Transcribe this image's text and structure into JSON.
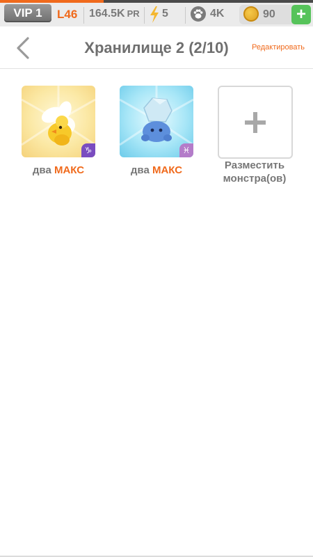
{
  "status_bar": {
    "vip_label": "VIP 1",
    "level": "L46",
    "power_value": "164.5K",
    "power_unit": "PR",
    "energy": "5",
    "paws": "4K",
    "coins": "90",
    "add_label": "+",
    "xp_progress_percent": 33,
    "colors": {
      "accent": "#f06a1c",
      "green": "#56c35a",
      "vip_gray": "#7a7a7a"
    }
  },
  "header": {
    "title": "Хранилище 2 (2/10)",
    "edit_label": "Редактировать"
  },
  "storage": {
    "slots": [
      {
        "prefix": "два",
        "rank": "МАКС",
        "zodiac_symbol": "♑",
        "theme": "yellow"
      },
      {
        "prefix": "два",
        "rank": "МАКС",
        "zodiac_symbol": "♓",
        "theme": "blue"
      }
    ],
    "add_slot": {
      "symbol": "+",
      "label": "Разместить монстра(ов)"
    }
  }
}
